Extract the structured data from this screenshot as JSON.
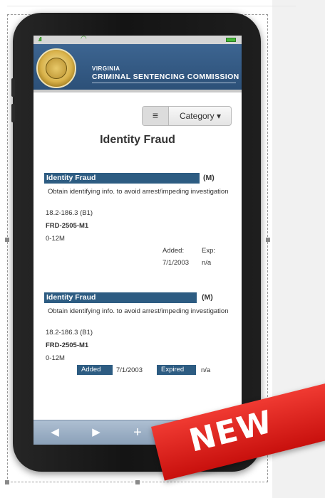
{
  "header": {
    "line1": "VIRGINIA",
    "line2": "CRIMINAL SENTENCING COMMISSION"
  },
  "toolbar_top": {
    "menu_icon": "≡",
    "category_label": "Category ▾"
  },
  "page_title": "Identity Fraud",
  "entry1": {
    "title": "Identity Fraud",
    "class": "(M)",
    "description": "Obtain identifying info. to avoid arrest/impeding investigation",
    "code": "18.2-186.3 (B1)",
    "vcc": "FRD-2505-M1",
    "range": "0-12M",
    "added_label": "Added:",
    "added_value": "7/1/2003",
    "exp_label": "Exp:",
    "exp_value": "n/a"
  },
  "entry2": {
    "title": "Identity Fraud",
    "class": "(M)",
    "description": "Obtain identifying info. to avoid arrest/impeding investigation",
    "code": "18.2-186.3 (B1)",
    "vcc": "FRD-2505-M1",
    "range": "0-12M",
    "added_label": "Added",
    "added_value": "7/1/2003",
    "expired_label": "Expired",
    "expired_value": "n/a"
  },
  "bottom_toolbar": {
    "back": "◀",
    "forward": "▶",
    "add": "+",
    "bookmarks": "☷",
    "tabs": "⧉"
  },
  "ribbon_text": "NEW",
  "colors": {
    "header_blue": "#2c5078",
    "bar_blue": "#2d5c82",
    "ribbon_red": "#d81e18"
  }
}
